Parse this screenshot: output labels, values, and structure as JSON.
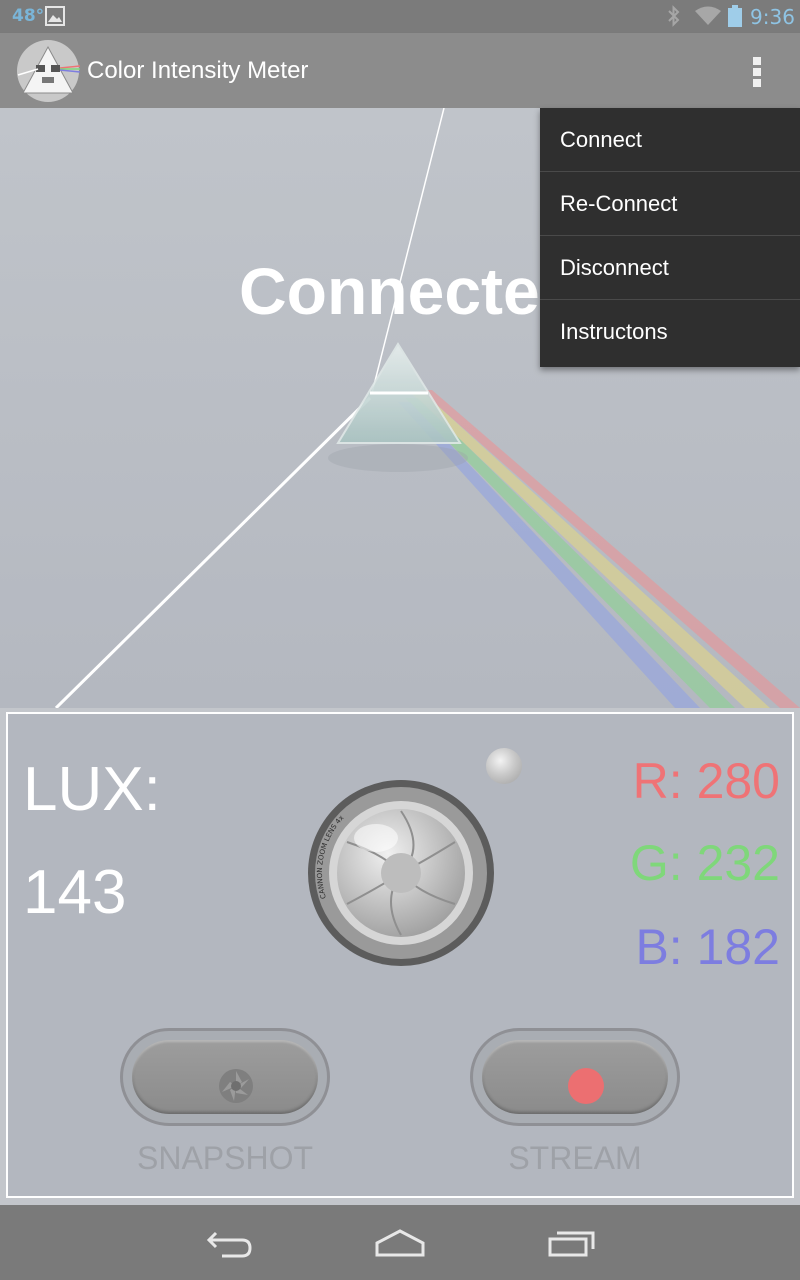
{
  "status_bar": {
    "temperature": "48°",
    "time": "9:36",
    "icons": [
      "gallery-icon",
      "bluetooth-icon",
      "wifi-icon",
      "battery-icon"
    ]
  },
  "action_bar": {
    "title": "Color Intensity Meter",
    "logo_icon": "prism-logo-icon",
    "overflow_icon": "overflow-menu-icon"
  },
  "hero": {
    "status_text": "Connected"
  },
  "menu": {
    "items": [
      "Connect",
      "Re-Connect",
      "Disconnect",
      "Instructons"
    ]
  },
  "meter": {
    "lux_label": "LUX:",
    "lux_value": "143",
    "r_text": "R: 280",
    "g_text": "G: 232",
    "b_text": "B: 182",
    "colors": {
      "r": "#ef7376",
      "g": "#7fd77a",
      "b": "#7d7de0"
    },
    "lens_text": "CANNON ZOOM LENS 4x"
  },
  "controls": {
    "snapshot_label": "SNAPSHOT",
    "stream_label": "STREAM",
    "record_color": "#ec6f71"
  },
  "nav_bar": {
    "icons": [
      "back-icon",
      "home-icon",
      "recent-apps-icon"
    ]
  }
}
